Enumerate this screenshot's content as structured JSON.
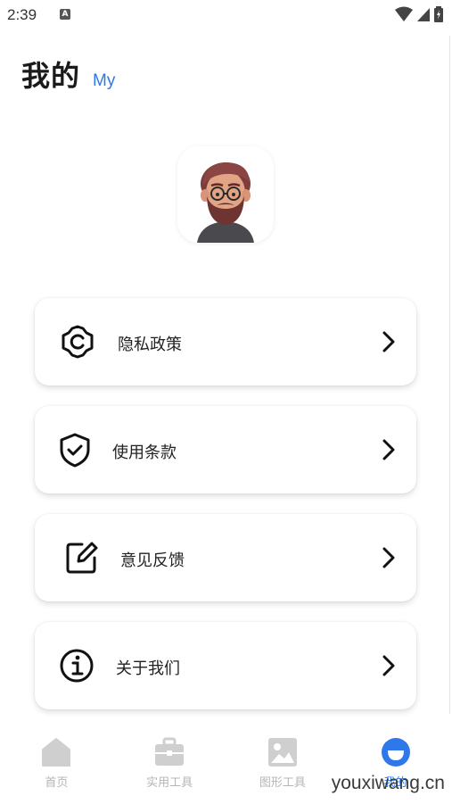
{
  "status_bar": {
    "time": "2:39",
    "app_icon_letter": "A"
  },
  "header": {
    "title": "我的",
    "subtitle": "My"
  },
  "menu": {
    "items": [
      {
        "label": "隐私政策",
        "icon": "settings-gear-icon"
      },
      {
        "label": "使用条款",
        "icon": "shield-check-icon"
      },
      {
        "label": "意见反馈",
        "icon": "edit-square-icon"
      },
      {
        "label": "关于我们",
        "icon": "info-circle-icon"
      }
    ]
  },
  "bottom_nav": {
    "items": [
      {
        "label": "首页",
        "icon": "home-icon",
        "active": false
      },
      {
        "label": "实用工具",
        "icon": "toolbox-icon",
        "active": false
      },
      {
        "label": "图形工具",
        "icon": "image-icon",
        "active": false
      },
      {
        "label": "我的",
        "icon": "smiley-icon",
        "active": true
      }
    ]
  },
  "colors": {
    "accent": "#2f78ea",
    "inactive_nav": "#c8c8c8",
    "text": "#222222"
  },
  "watermark": "youxiwang.cn"
}
